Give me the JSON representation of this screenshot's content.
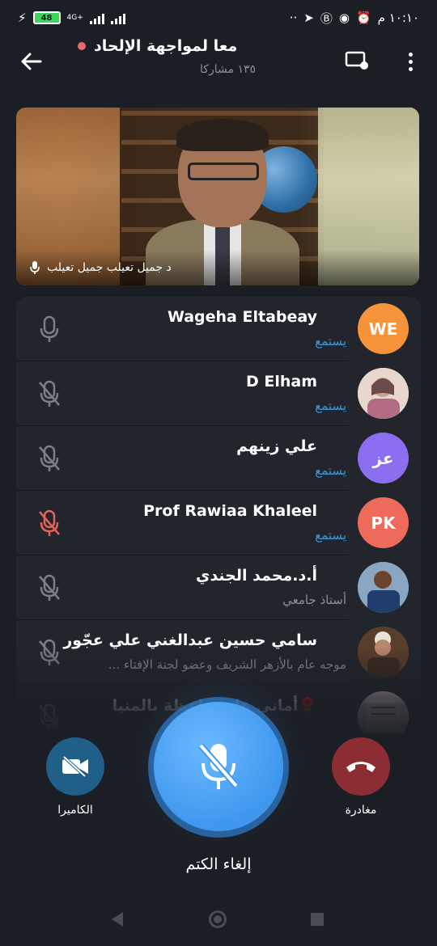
{
  "status_bar": {
    "time": "١٠:١٠ م",
    "battery": "48",
    "network": "4G+",
    "icons": [
      "alarm-icon",
      "whatsapp-icon",
      "b-icon",
      "telegram-icon",
      "dots-icon"
    ]
  },
  "header": {
    "title": "معا لمواجهة الإلحاد",
    "subtitle": "١٣٥ مشاركا"
  },
  "video": {
    "speaker_name": "د جميل تعيلب جميل تعيلب"
  },
  "participants": [
    {
      "name": "Wageha Eltabeay",
      "status": "يستمع",
      "avatar_text": "WE",
      "avatar_color": "#f5943a",
      "mic": "on-grey",
      "status_color": "blue"
    },
    {
      "name": "D Elham",
      "status": "يستمع",
      "avatar_text": "",
      "avatar_color": "#e8d7cf",
      "mic": "muted",
      "status_color": "blue"
    },
    {
      "name": "علي زينهم",
      "status": "يستمع",
      "avatar_text": "عز",
      "avatar_color": "#8c6ff0",
      "mic": "muted",
      "status_color": "blue"
    },
    {
      "name": "Prof Rawiaa Khaleel",
      "status": "يستمع",
      "avatar_text": "PK",
      "avatar_color": "#ee6a5b",
      "mic": "muted-red",
      "status_color": "blue"
    },
    {
      "name": "أ.د.محمد الجندي",
      "status": "أستاذ جامعي",
      "avatar_text": "",
      "avatar_color": "#3a7ec6",
      "mic": "muted",
      "status_color": "grey"
    },
    {
      "name": "سامي حسين عبدالغني علي عجّور",
      "status": "موجه عام بالأزهر الشريف وعضو لجنة الإفتاء ...",
      "avatar_text": "",
      "avatar_color": "#6b4d38",
      "mic": "muted",
      "status_color": "grey"
    },
    {
      "name": "🌹أماني علي واعظة بالمنيا",
      "status": "",
      "avatar_text": "",
      "avatar_color": "#c9a8b3",
      "mic": "muted",
      "status_color": "grey"
    }
  ],
  "controls": {
    "camera_label": "الكاميرا",
    "leave_label": "مغادرة",
    "mute_label": "إلغاء الكتم"
  },
  "colors": {
    "background": "#1b1e24",
    "list_bg": "#22252b",
    "listening_blue": "#3a9be0",
    "mute_button": "#3f97ee",
    "leave_button": "#8c2d33",
    "camera_button": "#1f5f88"
  }
}
